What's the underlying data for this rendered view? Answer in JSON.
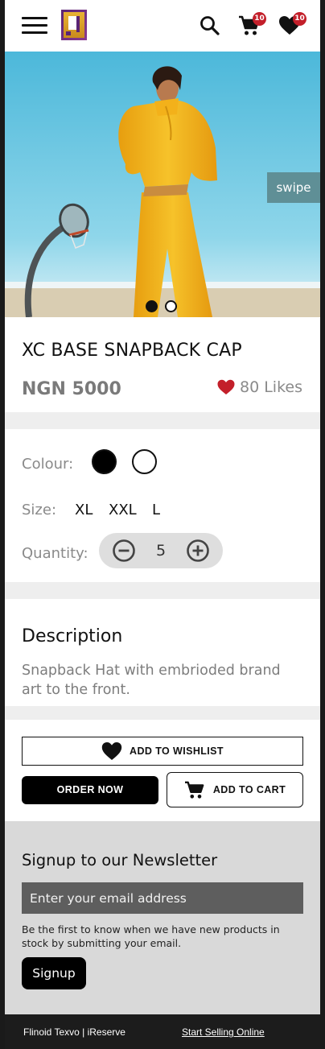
{
  "header": {
    "menu_icon": "hamburger-menu-icon",
    "logo_icon": "brand-logo",
    "cart_badge": "10",
    "wishlist_badge": "10",
    "colors": {
      "badge": "#c31f2a",
      "logo_gold": "#d9a42a",
      "logo_purple": "#5a2474"
    }
  },
  "hero": {
    "swipe_label": "swipe",
    "slides": 2,
    "active_slide": 1,
    "colors": {
      "sky": "#5dc4e0",
      "outfit": "#f1b417",
      "swipe_bg": "#5f8f96"
    }
  },
  "product": {
    "title": "XC BASE SNAPBACK CAP",
    "price": "NGN 5000",
    "likes": "80 Likes",
    "like_color": "#c31f2a"
  },
  "options": {
    "colour_label": "Colour:",
    "colours": [
      "#000000",
      "#ffffff"
    ],
    "size_label": "Size:",
    "sizes": [
      "XL",
      "XXL",
      "L"
    ],
    "quantity_label": "Quantity:",
    "quantity": "5"
  },
  "description": {
    "heading": "Description",
    "text": "Snapback Hat with embrioded brand art to the front."
  },
  "actions": {
    "wishlist": "ADD TO WISHLIST",
    "order": "ORDER NOW",
    "cart": "ADD TO CART"
  },
  "newsletter": {
    "heading": "Signup to our Newsletter",
    "email_placeholder": "Enter your email address",
    "text": "Be the first to know when we have new products in stock by submitting your email.",
    "button": "Signup"
  },
  "footer": {
    "left": "Flinoid Texvo | iReserve",
    "right": "Start Selling Online"
  }
}
